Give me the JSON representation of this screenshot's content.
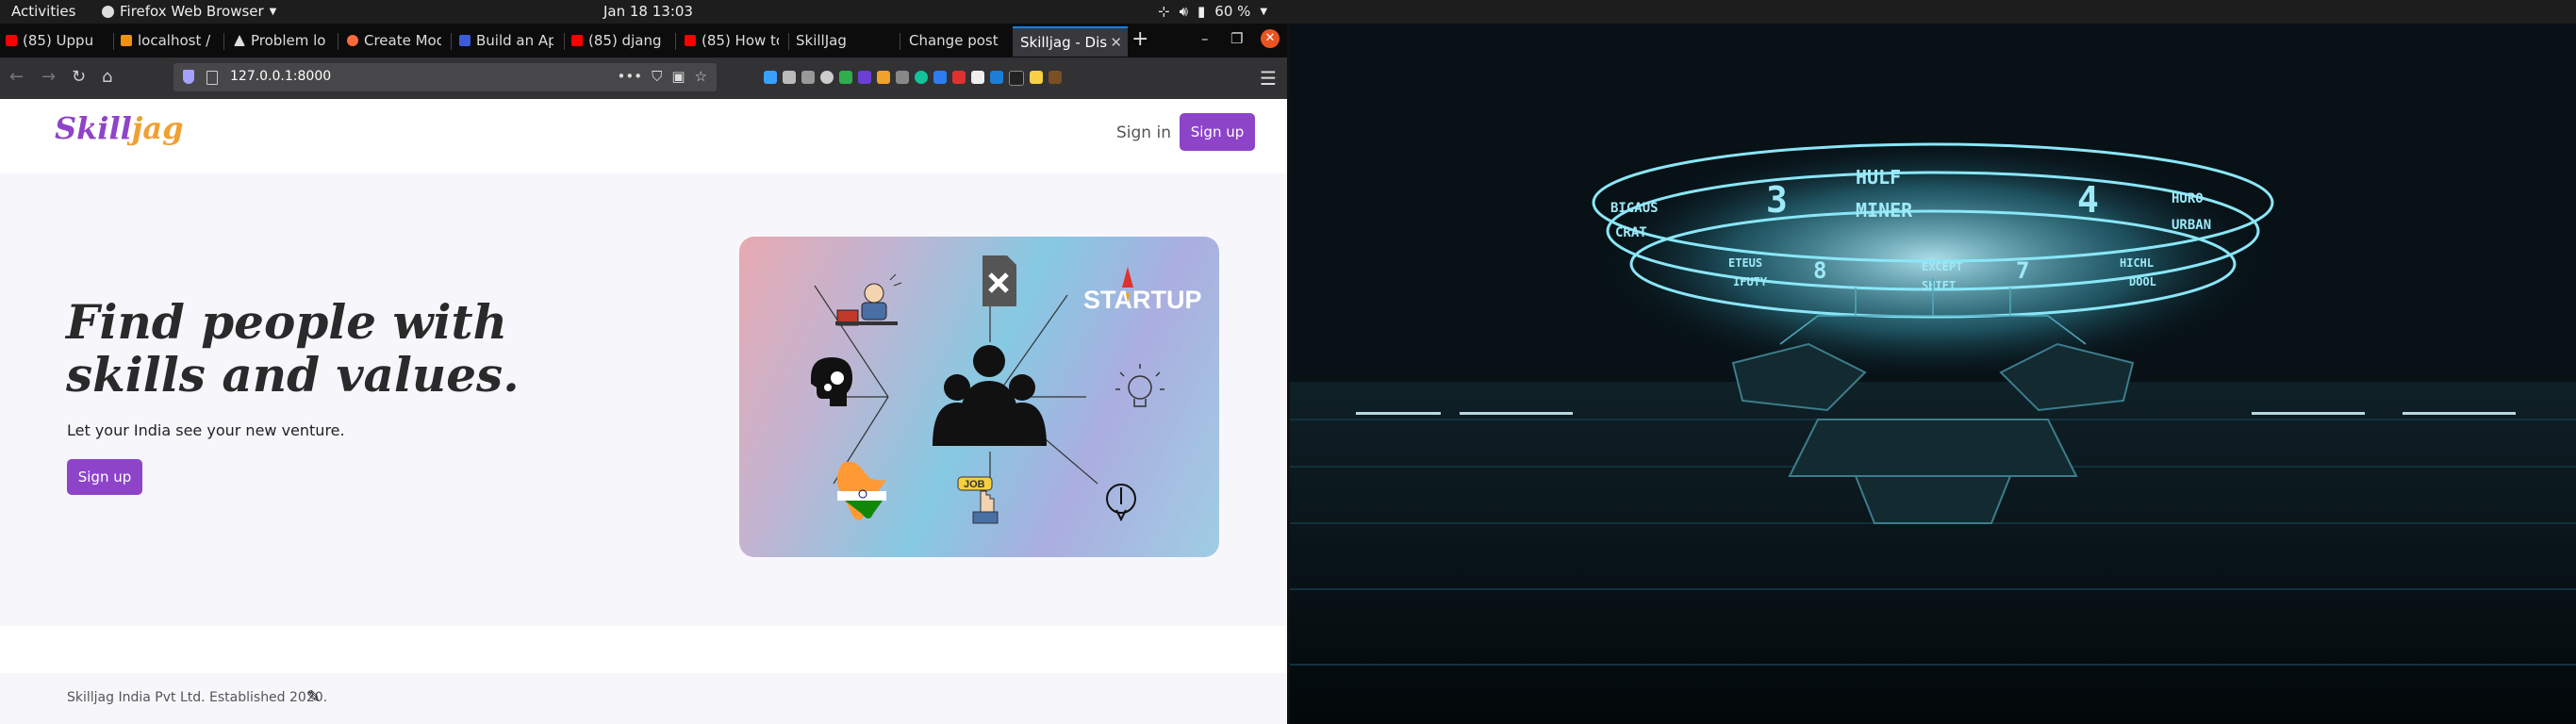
{
  "topbar": {
    "activities": "Activities",
    "app_menu": "Firefox Web Browser",
    "clock": "Jan 18  13:03",
    "battery": "60 %"
  },
  "browser": {
    "tabs": [
      {
        "label": "(85) Uppu",
        "favicon_color": "#ff0000"
      },
      {
        "label": "localhost /",
        "favicon_color": "#f29111"
      },
      {
        "label": "Problem lo",
        "favicon_color": "#dddddd"
      },
      {
        "label": "Create Mod",
        "favicon_color": "#ff6a3d"
      },
      {
        "label": "Build an Ap",
        "favicon_color": "#3b5bdb"
      },
      {
        "label": "(85) djang",
        "favicon_color": "#ff0000"
      },
      {
        "label": "(85) How to",
        "favicon_color": "#ff0000"
      },
      {
        "label": "SkillJag",
        "favicon_color": ""
      },
      {
        "label": "Change post",
        "favicon_color": ""
      },
      {
        "label": "Skilljag - Dis",
        "favicon_color": ""
      }
    ],
    "url": "127.0.0.1:8000"
  },
  "site": {
    "logo": "Skilljag",
    "nav_signin": "Sign in",
    "nav_signup": "Sign up",
    "hero_title": "Find people with skills and values.",
    "hero_subtitle": "Let your India see your new venture.",
    "hero_signup": "Sign up",
    "illustration": {
      "startup_text": "STARTUP",
      "job_text": "JOB"
    },
    "footer_text": "Skilljag India Pvt Ltd. Established 2020.",
    "accent_color": "#8d44c9"
  },
  "wallpaper": {
    "ring_labels": [
      "3",
      "HULF",
      "MINER",
      "4",
      "HURO",
      "URBAN",
      "BICAUS",
      "CRAT",
      "8",
      "7",
      "EXCEPT",
      "SHIFT",
      "HICHL",
      "DOOL",
      "ETEUS",
      "IFUTY"
    ]
  }
}
